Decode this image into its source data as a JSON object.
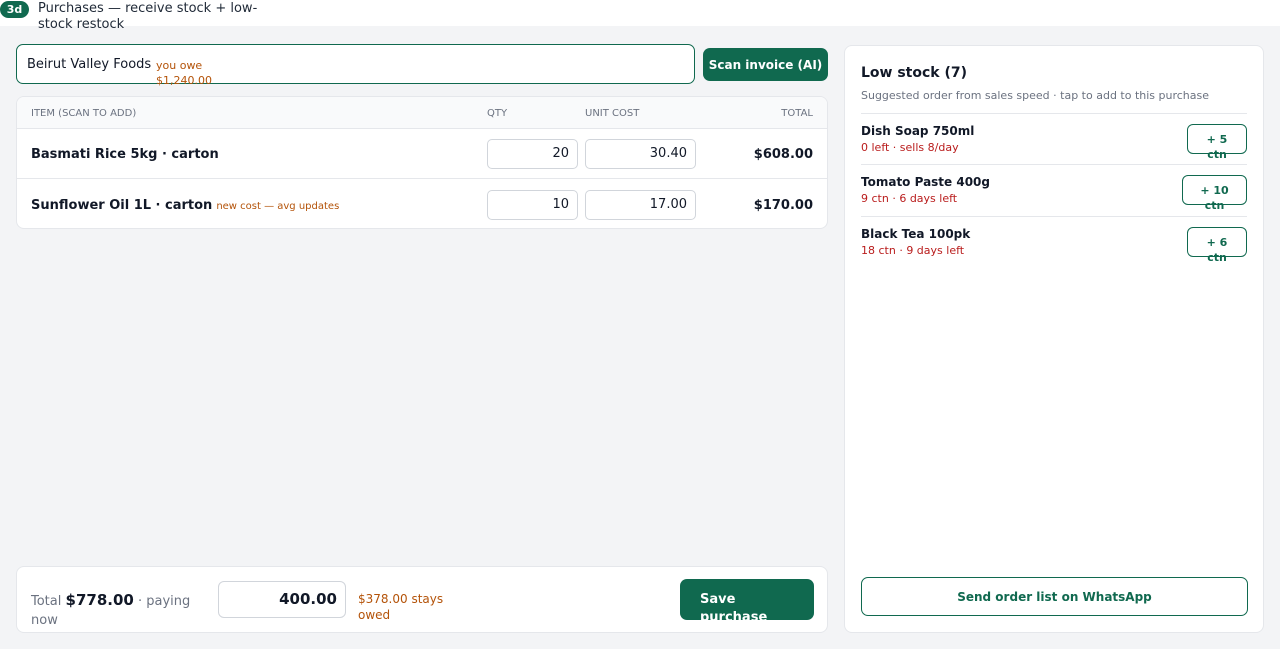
{
  "screen": {
    "badge": "3d",
    "title": "Purchases — receive stock + low-stock restock"
  },
  "supplier": {
    "name": "Beirut Valley Foods",
    "owe_label": "you owe",
    "owe_amount": "$1,240.00"
  },
  "scan_button": {
    "label": "Scan invoice (AI)"
  },
  "items_table": {
    "headers": {
      "item": "ITEM (SCAN TO ADD)",
      "qty": "QTY",
      "unit_cost": "UNIT COST",
      "total": "TOTAL"
    },
    "rows": [
      {
        "name": "Basmati Rice 5kg · carton",
        "note": "",
        "qty": "20",
        "unit_cost": "30.40",
        "total": "$608.00"
      },
      {
        "name": "Sunflower Oil 1L · carton",
        "note": "new cost — avg updates",
        "qty": "10",
        "unit_cost": "17.00",
        "total": "$170.00"
      }
    ]
  },
  "footer": {
    "total_label": "Total",
    "total_amount": "$778.00",
    "paying_label": "· paying now",
    "paying_value": "400.00",
    "owed_note": "$378.00 stays owed",
    "save_label": "Save purchase"
  },
  "low_stock": {
    "title": "Low stock (7)",
    "subtitle": "Suggested order from sales speed · tap to add to this purchase",
    "items": [
      {
        "name": "Dish Soap 750ml",
        "meta": "0 left · sells 8/day",
        "add_label": "+ 5 ctn"
      },
      {
        "name": "Tomato Paste 400g",
        "meta": "9 ctn · 6 days left",
        "add_label": "+ 10 ctn"
      },
      {
        "name": "Black Tea 100pk",
        "meta": "18 ctn · 9 days left",
        "add_label": "+ 6 ctn"
      }
    ],
    "whatsapp_label": "Send order list on WhatsApp"
  },
  "colors": {
    "accent": "#10694f",
    "warning": "#b45309",
    "danger": "#b91c1c"
  }
}
